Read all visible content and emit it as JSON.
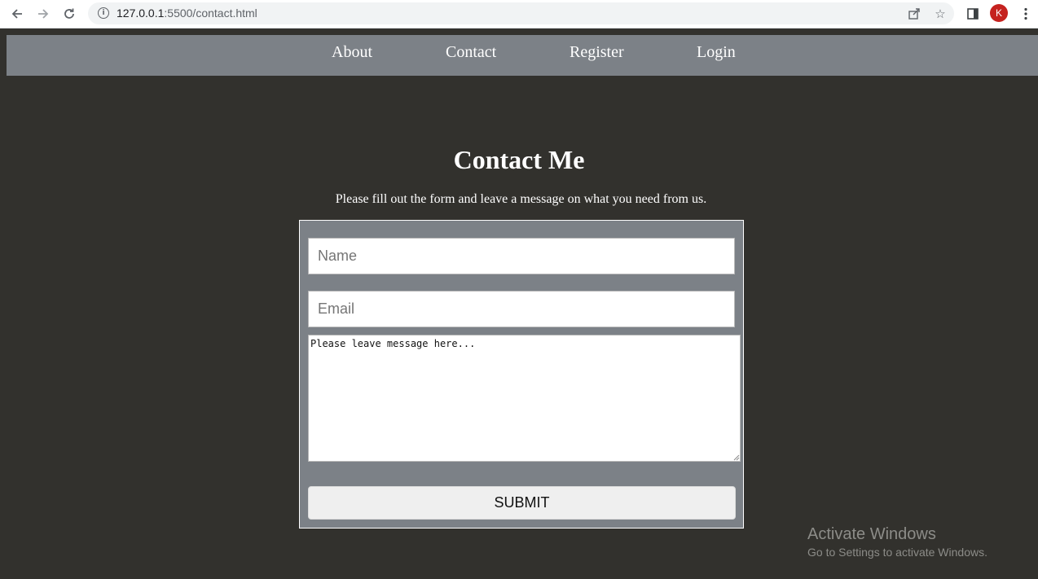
{
  "browser": {
    "url_host": "127.0.0.1",
    "url_rest": ":5500/contact.html",
    "profile_initial": "K",
    "profile_color": "#c5221f",
    "icons": [
      "back-arrow-icon",
      "forward-arrow-icon",
      "reload-icon",
      "info-icon",
      "share-icon",
      "bookmark-star-icon",
      "side-panel-icon",
      "kebab-menu-icon"
    ]
  },
  "nav": {
    "about": "About",
    "contact": "Contact",
    "register": "Register",
    "login": "Login"
  },
  "page": {
    "title": "Contact Me",
    "subtitle": "Please fill out the form and leave a message on what you need from us."
  },
  "form": {
    "name_placeholder": "Name",
    "name_value": "",
    "email_placeholder": "Email",
    "email_value": "",
    "message_placeholder": "Please leave message here...",
    "message_value": "",
    "submit_label": "SUBMIT"
  },
  "watermark": {
    "title": "Activate Windows",
    "subtitle": "Go to Settings to activate Windows."
  },
  "colors": {
    "page_bg": "#32312d",
    "panel_gray": "#7c8187",
    "text_white": "#ffffff"
  }
}
